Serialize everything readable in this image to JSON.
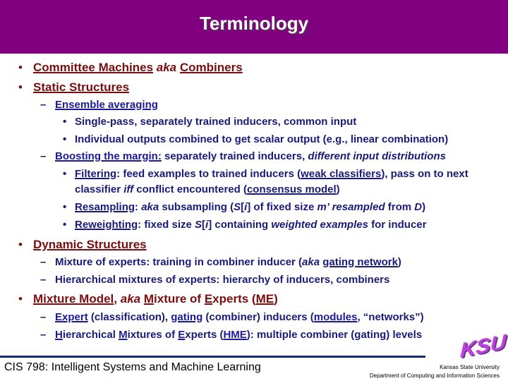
{
  "slide": {
    "title": "Terminology",
    "colors": {
      "title_bar": "#800080",
      "level1_text": "#7a0d0d",
      "level2_text": "#1a1a7a",
      "footer_rule": "#142a6e"
    }
  },
  "bullets": {
    "b1": {
      "marker": "•",
      "a": "Committee Machines",
      "b": " aka ",
      "c": "Combiners"
    },
    "b2": {
      "marker": "•",
      "a": "Static Structures"
    },
    "b2_1": {
      "marker": "–",
      "a": "Ensemble averaging"
    },
    "b2_1_1": {
      "marker": "•",
      "text": "Single-pass, separately trained inducers, common input"
    },
    "b2_1_2": {
      "marker": "•",
      "text": "Individual outputs combined to get scalar output (e.g., linear combination)"
    },
    "b2_2": {
      "marker": "–",
      "a": "Boosting the margin:",
      "b": " separately trained inducers, ",
      "c": "different input distributions"
    },
    "b2_2_1": {
      "marker": "•",
      "a": "Filtering",
      "b": ": feed examples to trained inducers (",
      "c": "weak classifiers",
      "d": "), pass on to next",
      "e": "classifier ",
      "f": "iff",
      "g": " conflict encountered (",
      "h": "consensus model",
      "i": ")"
    },
    "b2_2_2": {
      "marker": "•",
      "a": "Resampling",
      "b": ": ",
      "c": "aka",
      "d": " subsampling (",
      "e": "S",
      "f": "[",
      "g": "i",
      "h": "] of fixed size ",
      "i": "m’ resampled",
      "j": " from ",
      "k": "D",
      "l": ")"
    },
    "b2_2_3": {
      "marker": "•",
      "a": "Reweighting",
      "b": ": fixed size ",
      "c": "S",
      "d": "[",
      "e": "i",
      "f": "] containing ",
      "g": "weighted examples",
      "h": " for inducer"
    },
    "b3": {
      "marker": "•",
      "a": "Dynamic Structures"
    },
    "b3_1": {
      "marker": "–",
      "a": "Mixture of experts: training in combiner inducer (",
      "b": "aka",
      "c": " ",
      "d": "gating network",
      "e": ")"
    },
    "b3_2": {
      "marker": "–",
      "a": "Hierarchical mixtures of experts: hierarchy of inducers, combiners"
    },
    "b4": {
      "marker": "•",
      "a": "Mixture Model",
      "b": ", ",
      "c": "aka",
      "d": " ",
      "e": "M",
      "f": "ixture of ",
      "g": "E",
      "h": "xperts (",
      "i": "ME",
      "j": ")"
    },
    "b4_1": {
      "marker": "–",
      "a": "Expert",
      "b": " (classification), ",
      "c": "gating",
      "d": " (combiner) inducers (",
      "e": "modules",
      "f": ", “networks”)"
    },
    "b4_2": {
      "marker": "–",
      "a": "H",
      "b": "ierarchical ",
      "c": "M",
      "d": "ixtures of ",
      "e": "E",
      "f": "xperts (",
      "g": "HME",
      "h": "): multiple combiner (gating) levels"
    }
  },
  "footer": {
    "course": "CIS 798: Intelligent Systems and Machine Learning",
    "logo_text": "KSU",
    "university": "Kansas State University",
    "department": "Department of Computing and Information Sciences"
  }
}
